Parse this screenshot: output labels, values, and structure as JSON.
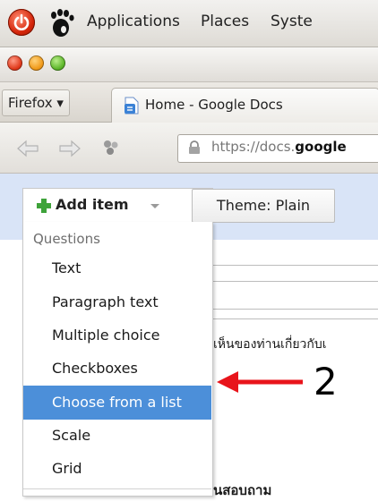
{
  "gnome_panel": {
    "menus": [
      "Applications",
      "Places",
      "Syste"
    ]
  },
  "browser": {
    "firefox_menu": "Firefox ▾",
    "tab_title": "Home - Google Docs",
    "url_prefix": "https://docs.",
    "url_bold": "google"
  },
  "toolbar": {
    "add_item_label": "Add item",
    "theme_label": "Theme:  Plain"
  },
  "dropdown": {
    "heading": "Questions",
    "items": [
      "Text",
      "Paragraph text",
      "Multiple choice",
      "Checkboxes",
      "Choose from a list",
      "Scale",
      "Grid"
    ],
    "selected": "Choose from a list"
  },
  "background": {
    "thai_text_1": "เห็นของท่านเกี่ยวกับเ",
    "thai_text_2": "นสอบถาม"
  },
  "annotation": {
    "number": "2",
    "arrow_color": "#e8141b"
  },
  "colors": {
    "selection": "#4c8fd9",
    "toolbar_bg": "#d9e4f7"
  }
}
